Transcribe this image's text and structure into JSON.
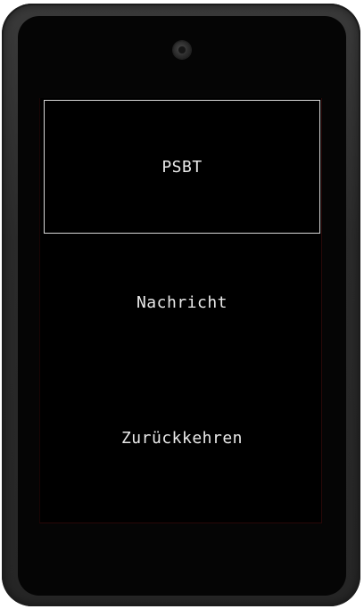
{
  "menu": {
    "items": [
      {
        "label": "PSBT",
        "selected": true
      },
      {
        "label": "Nachricht",
        "selected": false
      },
      {
        "label": "Zurückkehren",
        "selected": false
      }
    ]
  },
  "colors": {
    "screen_background": "#000000",
    "text": "#eaeaea",
    "selection_border": "#d8d8d8",
    "device_body": "#2e2e2e"
  },
  "icons": {
    "camera": "camera-icon"
  }
}
